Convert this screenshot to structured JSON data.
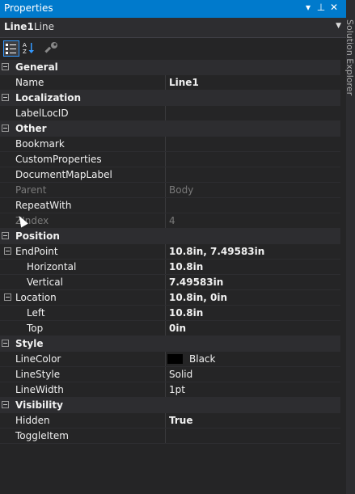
{
  "window": {
    "title": "Properties",
    "dropdown_glyph": "▾",
    "pin_glyph": "⊥",
    "close_glyph": "✕"
  },
  "object": {
    "name": "Line1",
    "type": "Line",
    "dropdown_glyph": "▼"
  },
  "side_tab": {
    "label": "Solution Explorer"
  },
  "toolbar": {
    "categorized_icon": "categorized-icon",
    "alphabetical_icon": "alphabetical-icon",
    "property_pages_icon": "wrench-icon"
  },
  "rows": [
    {
      "kind": "cat",
      "label": "General"
    },
    {
      "kind": "prop",
      "name": "Name",
      "value": "Line1",
      "bold": true
    },
    {
      "kind": "cat",
      "label": "Localization"
    },
    {
      "kind": "prop",
      "name": "LabelLocID",
      "value": ""
    },
    {
      "kind": "cat",
      "label": "Other"
    },
    {
      "kind": "prop",
      "name": "Bookmark",
      "value": ""
    },
    {
      "kind": "prop",
      "name": "CustomProperties",
      "value": ""
    },
    {
      "kind": "prop",
      "name": "DocumentMapLabel",
      "value": ""
    },
    {
      "kind": "prop",
      "name": "Parent",
      "value": "Body",
      "dim": true
    },
    {
      "kind": "prop",
      "name": "RepeatWith",
      "value": ""
    },
    {
      "kind": "prop",
      "name": "ZIndex",
      "value": "4",
      "dim": true
    },
    {
      "kind": "cat",
      "label": "Position"
    },
    {
      "kind": "prop",
      "name": "EndPoint",
      "value": "10.8in, 7.49583in",
      "bold": true,
      "expander": true
    },
    {
      "kind": "prop",
      "name": "Horizontal",
      "value": "10.8in",
      "bold": true,
      "sub": true
    },
    {
      "kind": "prop",
      "name": "Vertical",
      "value": "7.49583in",
      "bold": true,
      "sub": true
    },
    {
      "kind": "prop",
      "name": "Location",
      "value": "10.8in, 0in",
      "bold": true,
      "expander": true
    },
    {
      "kind": "prop",
      "name": "Left",
      "value": "10.8in",
      "bold": true,
      "sub": true
    },
    {
      "kind": "prop",
      "name": "Top",
      "value": "0in",
      "bold": true,
      "sub": true
    },
    {
      "kind": "cat",
      "label": "Style"
    },
    {
      "kind": "prop",
      "name": "LineColor",
      "value": "Black",
      "swatch": "#000000"
    },
    {
      "kind": "prop",
      "name": "LineStyle",
      "value": "Solid"
    },
    {
      "kind": "prop",
      "name": "LineWidth",
      "value": "1pt"
    },
    {
      "kind": "cat",
      "label": "Visibility"
    },
    {
      "kind": "prop",
      "name": "Hidden",
      "value": "True",
      "bold": true
    },
    {
      "kind": "prop",
      "name": "ToggleItem",
      "value": ""
    }
  ]
}
